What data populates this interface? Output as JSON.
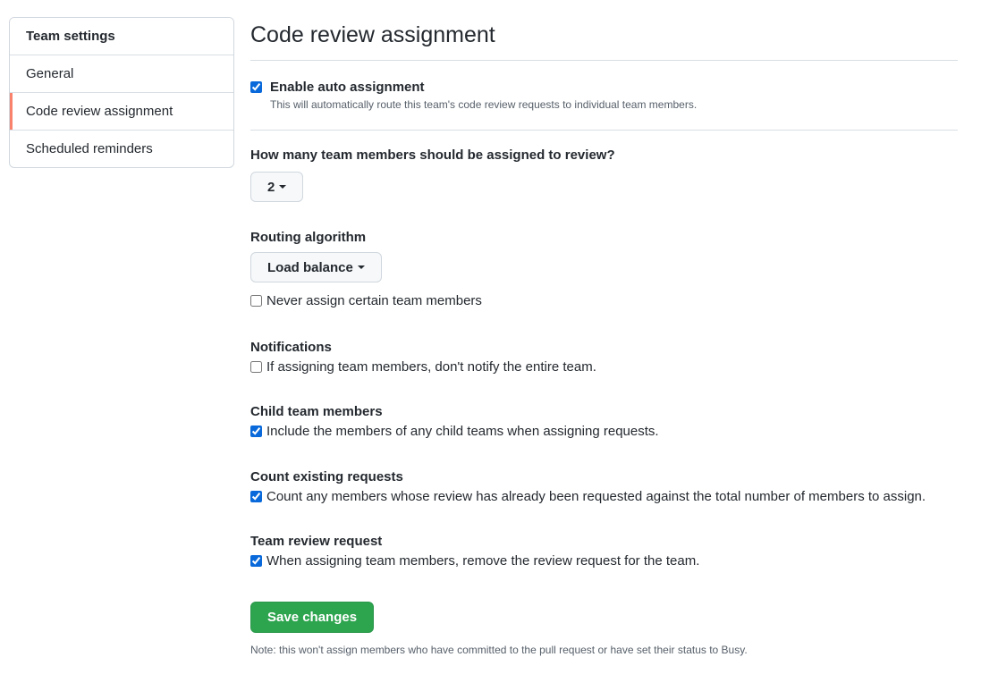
{
  "sidebar": {
    "header": "Team settings",
    "items": [
      {
        "label": "General"
      },
      {
        "label": "Code review assignment"
      },
      {
        "label": "Scheduled reminders"
      }
    ]
  },
  "main": {
    "title": "Code review assignment",
    "enable": {
      "label": "Enable auto assignment",
      "description": "This will automatically route this team's code review requests to individual team members.",
      "checked": true
    },
    "reviewer_count": {
      "question": "How many team members should be assigned to review?",
      "value": "2"
    },
    "routing": {
      "label": "Routing algorithm",
      "value": "Load balance",
      "never_assign_label": "Never assign certain team members",
      "never_assign_checked": false
    },
    "notifications": {
      "label": "Notifications",
      "option_label": "If assigning team members, don't notify the entire team.",
      "checked": false
    },
    "child_team": {
      "label": "Child team members",
      "option_label": "Include the members of any child teams when assigning requests.",
      "checked": true
    },
    "count_existing": {
      "label": "Count existing requests",
      "option_label": "Count any members whose review has already been requested against the total number of members to assign.",
      "checked": true
    },
    "team_review": {
      "label": "Team review request",
      "option_label": "When assigning team members, remove the review request for the team.",
      "checked": true
    },
    "save_label": "Save changes",
    "footnote": "Note: this won't assign members who have committed to the pull request or have set their status to Busy."
  },
  "colors": {
    "accent_selected": "#f9826c",
    "primary_button": "#2da44e",
    "checkbox": "#0969da"
  }
}
